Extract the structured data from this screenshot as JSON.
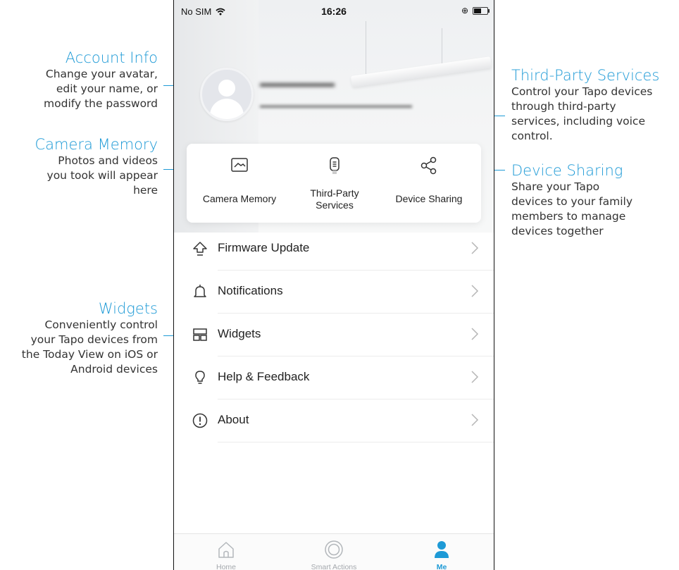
{
  "annotations": {
    "account_info": {
      "title": "Account Info",
      "lines": [
        "Change your avatar,",
        "edit your name, or",
        "modify the password"
      ]
    },
    "camera_memory": {
      "title": "Camera Memory",
      "lines": [
        "Photos and videos",
        "you took will appear",
        "here"
      ]
    },
    "widgets": {
      "title": "Widgets",
      "lines": [
        "Conveniently control",
        "your Tapo devices from",
        "the Today View on iOS or",
        "Android devices"
      ]
    },
    "third_party": {
      "title": "Third-Party Services",
      "lines": [
        "Control your Tapo devices",
        "through third-party",
        "services, including voice",
        "control."
      ]
    },
    "device_sharing": {
      "title": "Device Sharing",
      "lines": [
        "Share your Tapo",
        "devices to your family",
        "members to manage",
        "devices together"
      ]
    }
  },
  "status_bar": {
    "carrier": "No SIM",
    "time": "16:26",
    "rotation_icon": "rotation-lock-icon",
    "battery_icon": "battery-icon"
  },
  "account": {
    "name": "▬▬▬▬▬▬▬",
    "email": "▬▬▬▬▬▬▬▬▬▬▬▬▬▬▬▬▬▬"
  },
  "quick_actions": {
    "camera_memory": {
      "label": "Camera Memory",
      "icon": "photo-icon"
    },
    "third_party": {
      "line1": "Third-Party",
      "line2": "Services",
      "icon": "remote-icon"
    },
    "device_sharing": {
      "label": "Device Sharing",
      "icon": "share-icon"
    }
  },
  "menu": {
    "firmware": {
      "label": "Firmware Update",
      "icon": "upgrade-arrow-icon"
    },
    "notifications": {
      "label": "Notifications",
      "icon": "bell-icon"
    },
    "widgets": {
      "label": "Widgets",
      "icon": "widgets-icon"
    },
    "help": {
      "label": "Help & Feedback",
      "icon": "lightbulb-icon"
    },
    "about": {
      "label": "About",
      "icon": "info-exclamation-icon"
    }
  },
  "tab_bar": {
    "home": {
      "label": "Home",
      "icon": "home-icon"
    },
    "smart_actions": {
      "label": "Smart Actions",
      "icon": "smart-actions-icon"
    },
    "me": {
      "label": "Me",
      "icon": "person-icon",
      "active": true
    }
  },
  "colors": {
    "accent": "#1e9ad6",
    "text": "#222222",
    "muted": "#a4a8ad"
  }
}
